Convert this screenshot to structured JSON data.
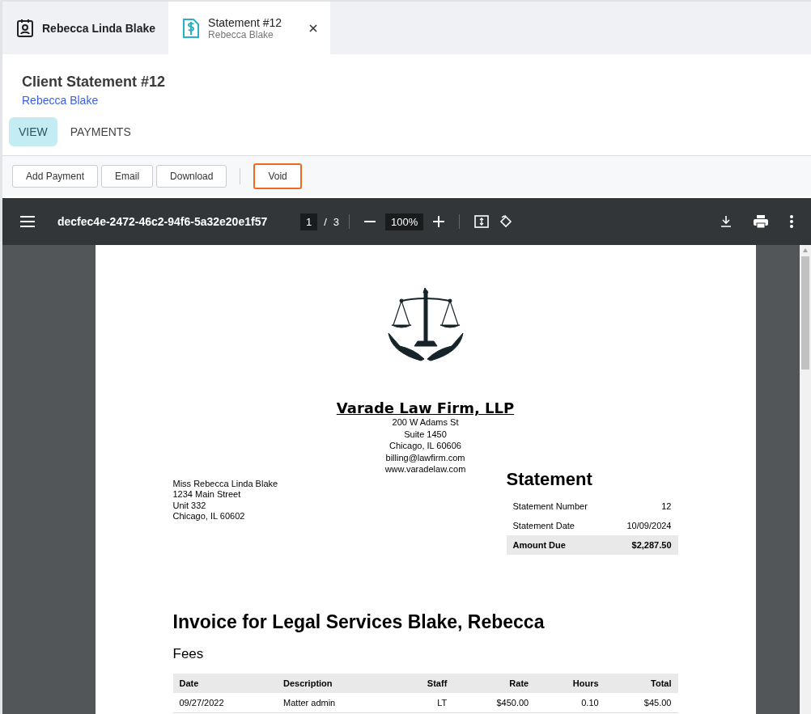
{
  "tabs": [
    {
      "kind": "contact",
      "title": "Rebecca Linda Blake",
      "selected": false
    },
    {
      "kind": "statement",
      "title": "Statement #12",
      "subtitle": "Rebecca Blake",
      "selected": true
    }
  ],
  "header": {
    "title": "Client Statement #12",
    "client_link": "Rebecca Blake"
  },
  "view_tabs": [
    {
      "label": "VIEW",
      "selected": true
    },
    {
      "label": "PAYMENTS",
      "selected": false
    }
  ],
  "actions": [
    {
      "label": "Add Payment",
      "highlighted": false
    },
    {
      "label": "Email",
      "highlighted": false
    },
    {
      "label": "Download",
      "highlighted": false
    },
    {
      "label": "Void",
      "highlighted": true
    }
  ],
  "pdf_viewer": {
    "file_name": "decfec4e-2472-46c2-94f6-5a32e20e1f57",
    "page": "1",
    "page_separator": "/",
    "page_count": "3",
    "zoom": "100%"
  },
  "document": {
    "firm": {
      "name": "Varade Law Firm, LLP",
      "lines": [
        "200 W Adams St",
        "Suite 1450",
        "Chicago, IL 60606",
        "billing@lawfirm.com",
        "www.varadelaw.com"
      ]
    },
    "client_address": [
      "Miss Rebecca Linda Blake",
      "1234 Main Street",
      "Unit 332",
      "Chicago, IL 60602"
    ],
    "statement": {
      "title": "Statement",
      "rows": [
        {
          "label": "Statement Number",
          "value": "12",
          "total": false
        },
        {
          "label": "Statement Date",
          "value": "10/09/2024",
          "total": false
        },
        {
          "label": "Amount Due",
          "value": "$2,287.50",
          "total": true
        }
      ]
    },
    "invoice_title": "Invoice for Legal Services Blake, Rebecca",
    "section": "Fees",
    "fees_table": {
      "columns": [
        "Date",
        "Description",
        "Staff",
        "Rate",
        "Hours",
        "Total"
      ],
      "rows": [
        [
          "09/27/2022",
          "Matter admin",
          "LT",
          "$450.00",
          "0.10",
          "$45.00"
        ]
      ]
    }
  }
}
